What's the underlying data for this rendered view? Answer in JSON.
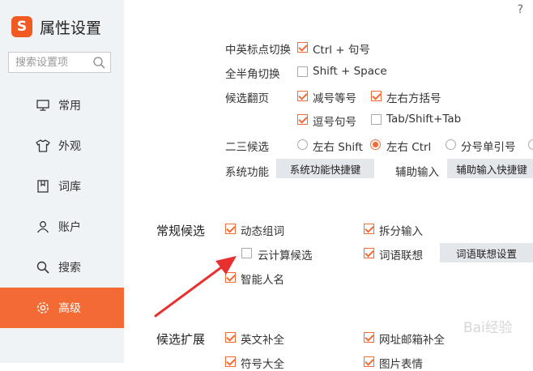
{
  "app": {
    "logo": "S",
    "title": "属性设置",
    "help": "?"
  },
  "search": {
    "placeholder": "搜索设置项"
  },
  "nav": [
    {
      "label": "常用",
      "icon": "monitor-icon"
    },
    {
      "label": "外观",
      "icon": "shirt-icon"
    },
    {
      "label": "词库",
      "icon": "book-icon"
    },
    {
      "label": "账户",
      "icon": "user-icon"
    },
    {
      "label": "搜索",
      "icon": "search-icon"
    },
    {
      "label": "高级",
      "icon": "gear-icon",
      "active": true
    }
  ],
  "general": {
    "punct_label": "中英标点切换",
    "punct_opt": "Ctrl + 句号",
    "width_label": "全半角切换",
    "width_opt": "Shift + Space",
    "page_label": "候选翻页",
    "page_opt1": "减号等号",
    "page_opt2": "左右方括号",
    "page_opt3": "逗号句号",
    "page_opt4": "Tab/Shift+Tab",
    "second_label": "二三候选",
    "second_opt1": "左右 Shift",
    "second_opt2": "左右 Ctrl",
    "second_opt3": "分号单引号",
    "sysfunc_label": "系统功能",
    "sysfunc_btn": "系统功能快捷键",
    "assist_label": "辅助输入",
    "assist_btn": "辅助输入快捷键"
  },
  "candidates": {
    "title": "常规候选",
    "dynamic": "动态组词",
    "split": "拆分输入",
    "cloud": "云计算候选",
    "assoc": "词语联想",
    "assoc_btn": "词语联想设置",
    "name": "智能人名"
  },
  "extension": {
    "title": "候选扩展",
    "english": "英文补全",
    "url": "网址邮箱补全",
    "symbol": "符号大全",
    "emoji": "图片表情"
  },
  "watermark": "Bai经验",
  "colors": {
    "accent": "#f36a35",
    "arrow": "#e8312f"
  }
}
